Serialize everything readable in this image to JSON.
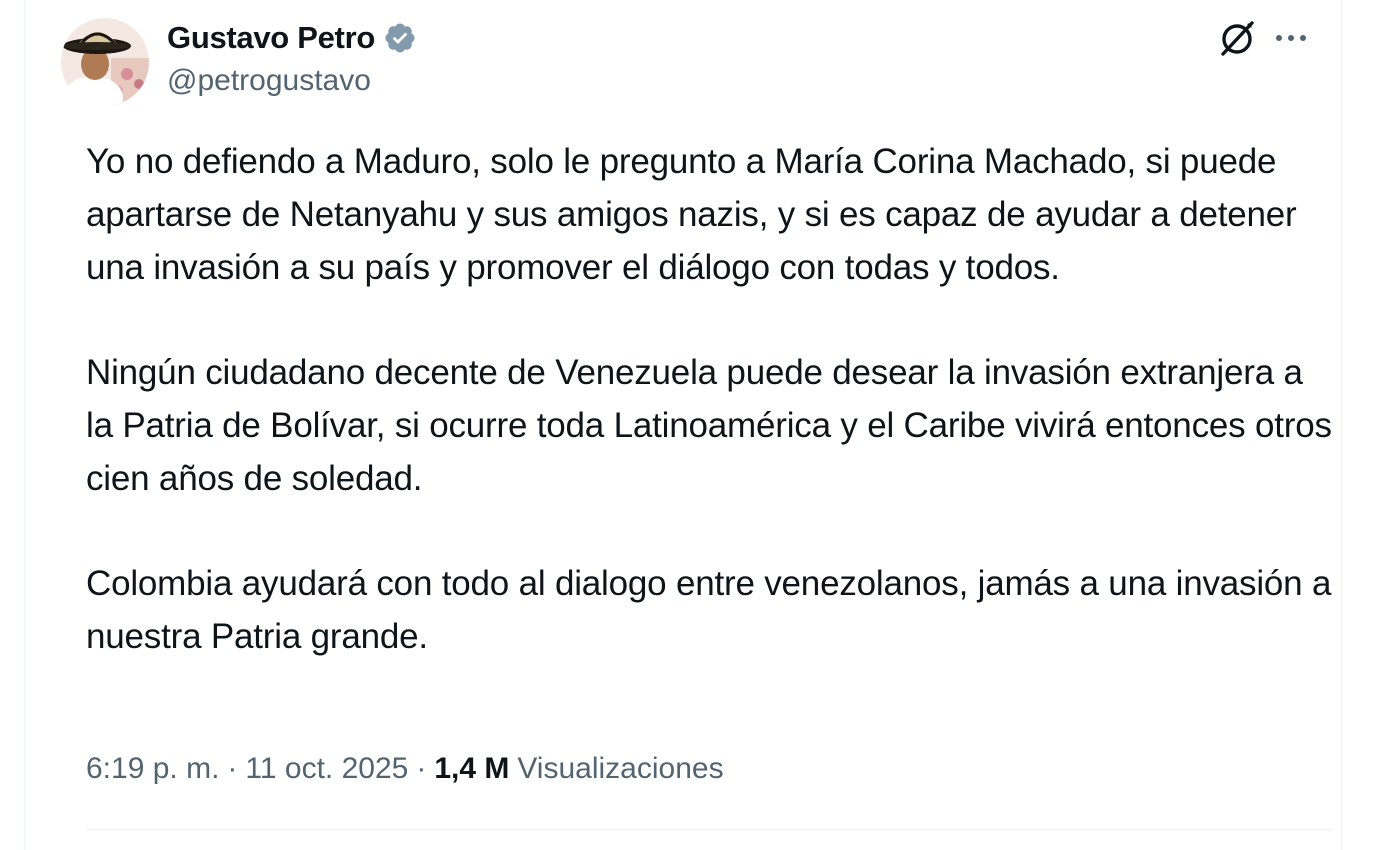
{
  "author": {
    "display_name": "Gustavo Petro",
    "handle": "@petrogustavo",
    "verified_icon": "verified-badge-icon",
    "avatar_icon": "avatar"
  },
  "actions": {
    "grok_icon": "grok-icon",
    "more_icon": "more-options-icon"
  },
  "post": {
    "paragraphs": [
      "Yo no defiendo a Maduro, solo le pregunto a María Corina Machado, si puede apartarse de Netanyahu y sus amigos nazis, y si es capaz de ayudar a detener una invasión a su país y promover el diálogo con todas y todos.",
      "Ningún ciudadano decente de Venezuela puede desear la invasión extranjera a la Patria de Bolívar, si ocurre toda Latinoamérica y el Caribe vivirá entonces otros cien años de soledad.",
      "Colombia ayudará con todo al dialogo entre venezolanos, jamás a una invasión a nuestra Patria grande."
    ]
  },
  "meta": {
    "time": "6:19 p. m.",
    "separator": "·",
    "date": "11 oct. 2025",
    "views_count": "1,4 M",
    "views_label": "Visualizaciones"
  },
  "colors": {
    "text_primary": "#0f1419",
    "text_secondary": "#536471",
    "verified_blue": "#829aab",
    "divider": "#eff3f4"
  }
}
